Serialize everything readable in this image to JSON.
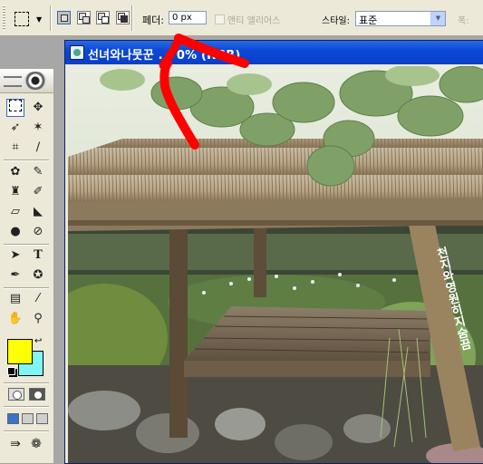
{
  "options_bar": {
    "feather_label": "페더:",
    "feather_value": "0 px",
    "antialias_label": "앤티 앨리어스",
    "style_label": "스타일:",
    "style_value": "표준",
    "width_label": "폭:"
  },
  "tools_palette": {
    "type_tool_glyph": "T",
    "foreground_color": "#ffff00",
    "background_color": "#7ff5f5"
  },
  "document": {
    "title": "선녀와나뭇꾼 ... 0% (RGB)",
    "sign_text": "천지와영원히지숨끔"
  },
  "colors": {
    "titlebar": "#0a48d8",
    "annotation_arrow": "#ff0000",
    "ui_face": "#ece9d8"
  }
}
